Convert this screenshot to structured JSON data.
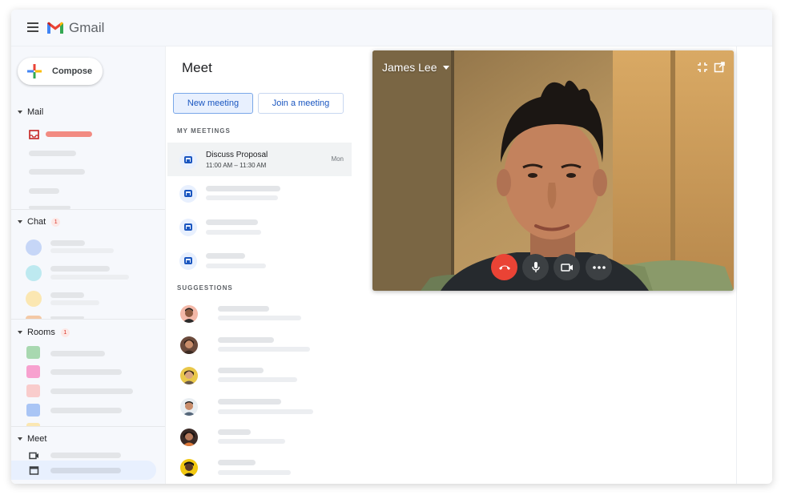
{
  "app": {
    "title": "Gmail"
  },
  "sidebar": {
    "compose_label": "Compose",
    "sections": {
      "mail": {
        "label": "Mail"
      },
      "chat": {
        "label": "Chat",
        "badge": "1"
      },
      "rooms": {
        "label": "Rooms",
        "badge": "1"
      },
      "meet": {
        "label": "Meet"
      }
    },
    "chat_avatar_colors": [
      "#c6d6f7",
      "#bde9f0",
      "#fbe7b2",
      "#f4c9a6"
    ],
    "room_colors": [
      "#a8d8b0",
      "#f7a1cf",
      "#f9cccc",
      "#a9c5f5",
      "#fbe7b2"
    ],
    "accent_color": "#e8f0fe"
  },
  "meet_panel": {
    "title": "Meet",
    "new_meeting_label": "New meeting",
    "join_meeting_label": "Join a meeting",
    "my_meetings_heading": "MY MEETINGS",
    "meetings": [
      {
        "title": "Discuss Proposal",
        "time": "11:00 AM – 11:30 AM",
        "day": "Mon"
      }
    ],
    "suggestions_heading": "SUGGESTIONS"
  },
  "video_call": {
    "participant_name": "James Lee",
    "icons": [
      "exit-fullscreen-icon",
      "popout-icon",
      "end-call-icon",
      "microphone-icon",
      "camera-icon",
      "more-options-icon"
    ],
    "end_call_color": "#ea4335"
  }
}
